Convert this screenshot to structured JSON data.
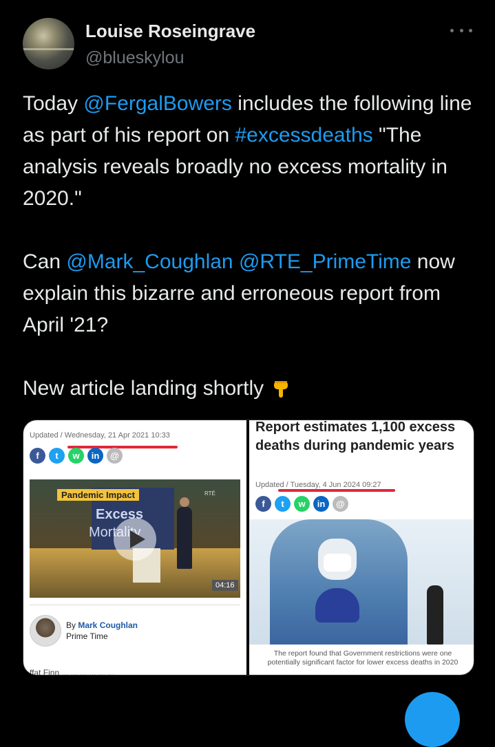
{
  "author": {
    "display_name": "Louise Roseingrave",
    "handle": "@blueskylou"
  },
  "tweet": {
    "p1": [
      {
        "text": "Today ",
        "type": "text"
      },
      {
        "text": "@FergalBowers",
        "type": "link"
      },
      {
        "text": " includes the following line as part of his report on ",
        "type": "text"
      },
      {
        "text": "#excessdeaths",
        "type": "link"
      },
      {
        "text": " \"The analysis reveals broadly no excess mortality in 2020.\"",
        "type": "text"
      }
    ],
    "p2": [
      {
        "text": "Can ",
        "type": "text"
      },
      {
        "text": "@Mark_Coughlan",
        "type": "link"
      },
      {
        "text": " ",
        "type": "text"
      },
      {
        "text": "@RTE_PrimeTime",
        "type": "link"
      },
      {
        "text": " now explain this bizarre and erroneous report from April '21?",
        "type": "text"
      }
    ],
    "p3_text": "New article landing shortly",
    "p3_emoji": "pointing-down-hand-icon"
  },
  "media": {
    "left": {
      "updated": "Updated / Wednesday, 21 Apr 2021 10:33",
      "video_tag": "Pandemic Impact",
      "video_title_line1": "Excess",
      "video_title_line2": "Mortality",
      "video_logo": "RTÉ",
      "duration": "04:16",
      "by_prefix": "By ",
      "author": "Mark Coughlan",
      "show": "Prime Time",
      "cut_text": "ffat Finn ... ... ... ... ... ..."
    },
    "right": {
      "headline": "Report estimates 1,100 excess deaths during pandemic years",
      "updated": "Updated / Tuesday, 4 Jun 2024 09:27",
      "caption": "The report found that Government restrictions were one potentially significant factor for lower excess deaths in 2020"
    },
    "social_icons": [
      "f",
      "t",
      "w",
      "in",
      "@"
    ]
  },
  "colors": {
    "background": "#000000",
    "text": "#e7e9ea",
    "muted": "#71767b",
    "link": "#1d9bf0",
    "underline_red": "#e0283a"
  }
}
